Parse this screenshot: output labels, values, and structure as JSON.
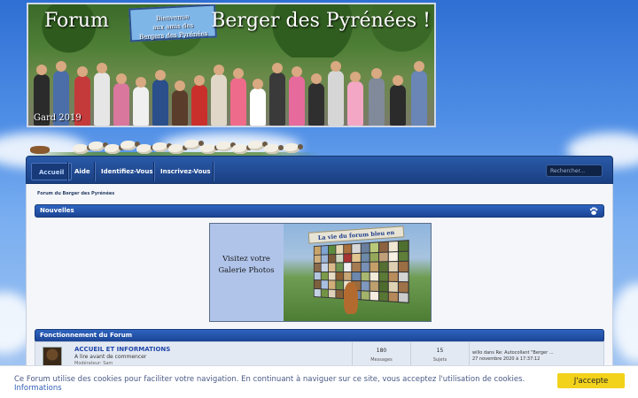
{
  "banner": {
    "title_left": "Forum",
    "title_right": "Berger des Pyrénées !",
    "sign_line1": "Bienvenue",
    "sign_line2": "aux amis des",
    "sign_line3": "Bergers des Pyrénées",
    "year": "Gard 2019"
  },
  "nav": {
    "items": [
      {
        "label": "Accueil",
        "active": true
      },
      {
        "label": "Aide"
      },
      {
        "label": "Identifiez-Vous"
      },
      {
        "label": "Inscrivez-Vous"
      }
    ],
    "search_placeholder": "Rechercher..."
  },
  "breadcrumb": "Forum du Berger des Pyrénées",
  "sections": {
    "news": "Nouvelles",
    "functioning": "Fonctionnement du Forum"
  },
  "gallery": {
    "left_line1": "Visitez votre",
    "left_line2": "Galerie Photos",
    "right_title": "La vie du forum bleu en images"
  },
  "forum": {
    "title": "ACCUEIL ET INFORMATIONS",
    "description": "A lire avant de commencer",
    "moderator": "Modérateur: Sam",
    "messages_count": "180",
    "messages_label": "Messages",
    "topics_count": "15",
    "topics_label": "Sujets",
    "last_post_line1": "willo dans Re: Autocollant \"Berger ...",
    "last_post_line2": "27 novembre 2020 à 17:37:12"
  },
  "cookie": {
    "text": "Ce Forum utilise des cookies pour faciliter votre navigation. En continuant à naviguer sur ce site, vous acceptez l'utilisation de cookies.",
    "link": "Informations",
    "button": "J'accepte"
  },
  "colors": {
    "nav_bg": "#1a3f82",
    "category_bar": "#2e64c0",
    "accept_button": "#f2d21b",
    "link": "#1f47a8"
  }
}
